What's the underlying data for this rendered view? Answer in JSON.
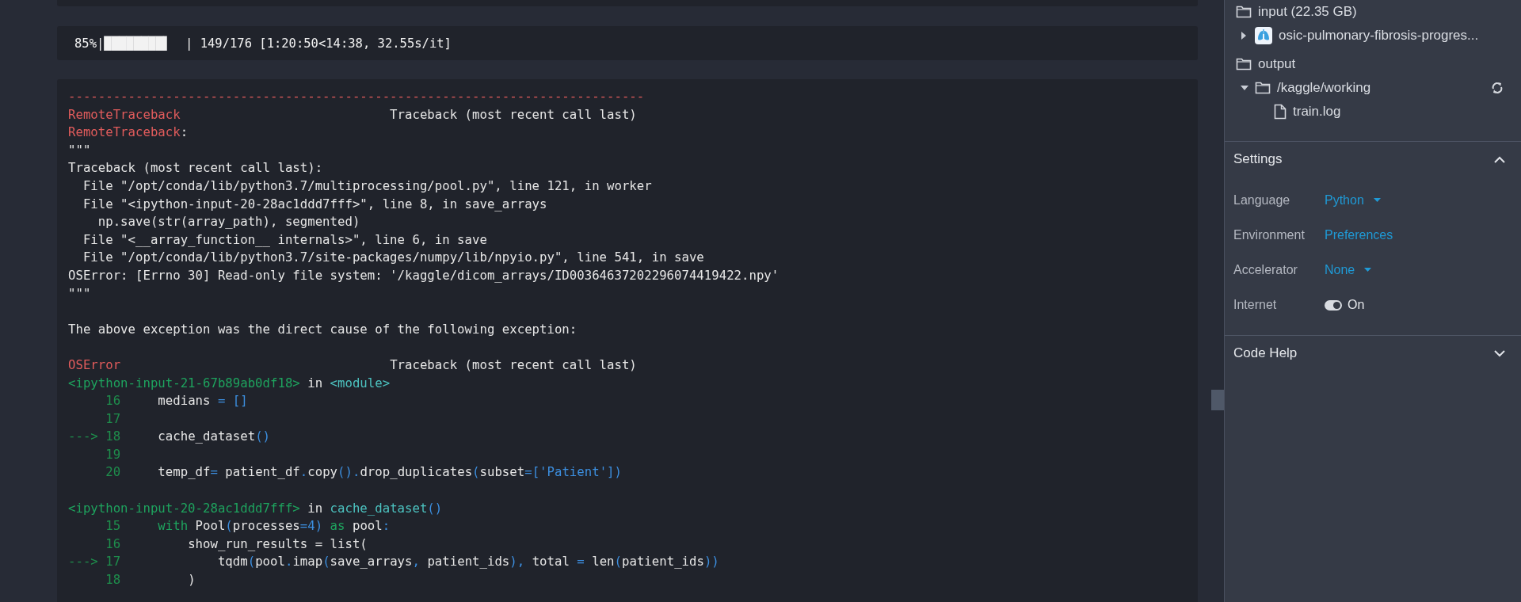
{
  "progress_output": {
    "text": "85%|████████▌  | 149/176 [1:20:50<14:38, 32.55s/it]"
  },
  "error_output": {
    "lines": [
      {
        "kind": "code",
        "segments": [
          {
            "kind": "red",
            "text": "-----------------------------------------------------------------------------"
          }
        ]
      },
      {
        "kind": "code",
        "segments": [
          {
            "kind": "red",
            "text": "RemoteTraceback"
          },
          {
            "kind": "plain",
            "text": "                            Traceback (most recent call last)"
          }
        ]
      },
      {
        "kind": "code",
        "segments": [
          {
            "kind": "red",
            "text": "RemoteTraceback"
          },
          {
            "kind": "plain",
            "text": ":"
          }
        ]
      },
      {
        "kind": "code",
        "segments": [
          {
            "kind": "plain",
            "text": "\"\"\""
          }
        ]
      },
      {
        "kind": "code",
        "segments": [
          {
            "kind": "plain",
            "text": "Traceback (most recent call last):"
          }
        ]
      },
      {
        "kind": "code",
        "segments": [
          {
            "kind": "plain",
            "text": "  File \"/opt/conda/lib/python3.7/multiprocessing/pool.py\", line 121, in worker"
          }
        ]
      },
      {
        "kind": "code",
        "segments": [
          {
            "kind": "plain",
            "text": "  File \"<ipython-input-20-28ac1ddd7fff>\", line 8, in save_arrays"
          }
        ]
      },
      {
        "kind": "code",
        "segments": [
          {
            "kind": "plain",
            "text": "    np.save(str(array_path), segmented)"
          }
        ]
      },
      {
        "kind": "code",
        "segments": [
          {
            "kind": "plain",
            "text": "  File \"<__array_function__ internals>\", line 6, in save"
          }
        ]
      },
      {
        "kind": "code",
        "segments": [
          {
            "kind": "plain",
            "text": "  File \"/opt/conda/lib/python3.7/site-packages/numpy/lib/npyio.py\", line 541, in save"
          }
        ]
      },
      {
        "kind": "code",
        "segments": [
          {
            "kind": "plain",
            "text": "OSError: [Errno 30] Read-only file system: '/kaggle/dicom_arrays/ID00364637202296074419422.npy'"
          }
        ]
      },
      {
        "kind": "code",
        "segments": [
          {
            "kind": "plain",
            "text": "\"\"\""
          }
        ]
      },
      {
        "kind": "blank"
      },
      {
        "kind": "code",
        "segments": [
          {
            "kind": "plain",
            "text": "The above exception was the direct cause of the following exception:"
          }
        ]
      },
      {
        "kind": "blank"
      },
      {
        "kind": "code",
        "segments": [
          {
            "kind": "red",
            "text": "OSError"
          },
          {
            "kind": "plain",
            "text": "                                    Traceback (most recent call last)"
          }
        ]
      },
      {
        "kind": "code",
        "segments": [
          {
            "kind": "green",
            "text": "<ipython-input-21-67b89ab0df18>"
          },
          {
            "kind": "plain",
            "text": " in "
          },
          {
            "kind": "cyan",
            "text": "<module>"
          }
        ]
      },
      {
        "kind": "code",
        "segments": [
          {
            "kind": "lnum",
            "text": "     16"
          },
          {
            "kind": "plain",
            "text": "     medians "
          },
          {
            "kind": "blue",
            "text": "= []"
          }
        ]
      },
      {
        "kind": "code",
        "segments": [
          {
            "kind": "lnum",
            "text": "     17"
          }
        ]
      },
      {
        "kind": "code",
        "segments": [
          {
            "kind": "lnum",
            "text": "---> 18"
          },
          {
            "kind": "plain",
            "text": "     cache_dataset"
          },
          {
            "kind": "blue",
            "text": "()"
          }
        ]
      },
      {
        "kind": "code",
        "segments": [
          {
            "kind": "lnum",
            "text": "     19"
          }
        ]
      },
      {
        "kind": "code",
        "segments": [
          {
            "kind": "lnum",
            "text": "     20"
          },
          {
            "kind": "plain",
            "text": "     temp_df"
          },
          {
            "kind": "blue",
            "text": "="
          },
          {
            "kind": "plain",
            "text": " patient_df"
          },
          {
            "kind": "blue",
            "text": "."
          },
          {
            "kind": "plain",
            "text": "copy"
          },
          {
            "kind": "blue",
            "text": "()."
          },
          {
            "kind": "plain",
            "text": "drop_duplicates"
          },
          {
            "kind": "blue",
            "text": "("
          },
          {
            "kind": "plain",
            "text": "subset"
          },
          {
            "kind": "blue",
            "text": "=['Patient'])"
          }
        ]
      },
      {
        "kind": "blank"
      },
      {
        "kind": "code",
        "segments": [
          {
            "kind": "green",
            "text": "<ipython-input-20-28ac1ddd7fff>"
          },
          {
            "kind": "plain",
            "text": " in "
          },
          {
            "kind": "cyan",
            "text": "cache_dataset"
          },
          {
            "kind": "blue",
            "text": "()"
          }
        ]
      },
      {
        "kind": "code",
        "segments": [
          {
            "kind": "lnum",
            "text": "     15     "
          },
          {
            "kind": "green",
            "text": "with"
          },
          {
            "kind": "plain",
            "text": " Pool"
          },
          {
            "kind": "blue",
            "text": "("
          },
          {
            "kind": "plain",
            "text": "processes"
          },
          {
            "kind": "blue",
            "text": "=4) "
          },
          {
            "kind": "green",
            "text": "as"
          },
          {
            "kind": "plain",
            "text": " pool"
          },
          {
            "kind": "blue",
            "text": ":"
          }
        ]
      },
      {
        "kind": "code",
        "segments": [
          {
            "kind": "lnum",
            "text": "     16"
          },
          {
            "kind": "plain",
            "text": "         show_run_results = list("
          }
        ]
      },
      {
        "kind": "code",
        "segments": [
          {
            "kind": "lnum",
            "text": "---> 17"
          },
          {
            "kind": "plain",
            "text": "             tqdm"
          },
          {
            "kind": "blue",
            "text": "("
          },
          {
            "kind": "plain",
            "text": "pool"
          },
          {
            "kind": "blue",
            "text": "."
          },
          {
            "kind": "plain",
            "text": "imap"
          },
          {
            "kind": "blue",
            "text": "("
          },
          {
            "kind": "plain",
            "text": "save_arrays"
          },
          {
            "kind": "blue",
            "text": ","
          },
          {
            "kind": "plain",
            "text": " patient_ids"
          },
          {
            "kind": "blue",
            "text": "),"
          },
          {
            "kind": "plain",
            "text": " total "
          },
          {
            "kind": "blue",
            "text": "="
          },
          {
            "kind": "plain",
            "text": " len"
          },
          {
            "kind": "blue",
            "text": "("
          },
          {
            "kind": "plain",
            "text": "patient_ids"
          },
          {
            "kind": "blue",
            "text": "))"
          }
        ]
      },
      {
        "kind": "code",
        "segments": [
          {
            "kind": "lnum",
            "text": "     18"
          },
          {
            "kind": "plain",
            "text": "         )"
          }
        ]
      }
    ]
  },
  "sidebar": {
    "tree": [
      {
        "label": "input (22.35 GB)",
        "kind": "folder",
        "children": [
          {
            "label": "osic-pulmonary-fibrosis-progres...",
            "kind": "dataset",
            "expanded": false
          }
        ]
      },
      {
        "label": "output",
        "kind": "folder",
        "children": [
          {
            "label": "/kaggle/working",
            "kind": "folder",
            "expanded": true,
            "syncable": true,
            "children": [
              {
                "label": "train.log",
                "kind": "file"
              }
            ]
          }
        ]
      }
    ],
    "settings": {
      "title": "Settings",
      "expanded": true,
      "rows": [
        {
          "label": "Language",
          "value": "Python",
          "kind": "dropdown"
        },
        {
          "label": "Environment",
          "value": "Preferences",
          "kind": "link"
        },
        {
          "label": "Accelerator",
          "value": "None",
          "kind": "dropdown"
        },
        {
          "label": "Internet",
          "value": "On",
          "kind": "toggle",
          "on": true
        }
      ]
    },
    "code_help": {
      "title": "Code Help",
      "expanded": false
    }
  }
}
